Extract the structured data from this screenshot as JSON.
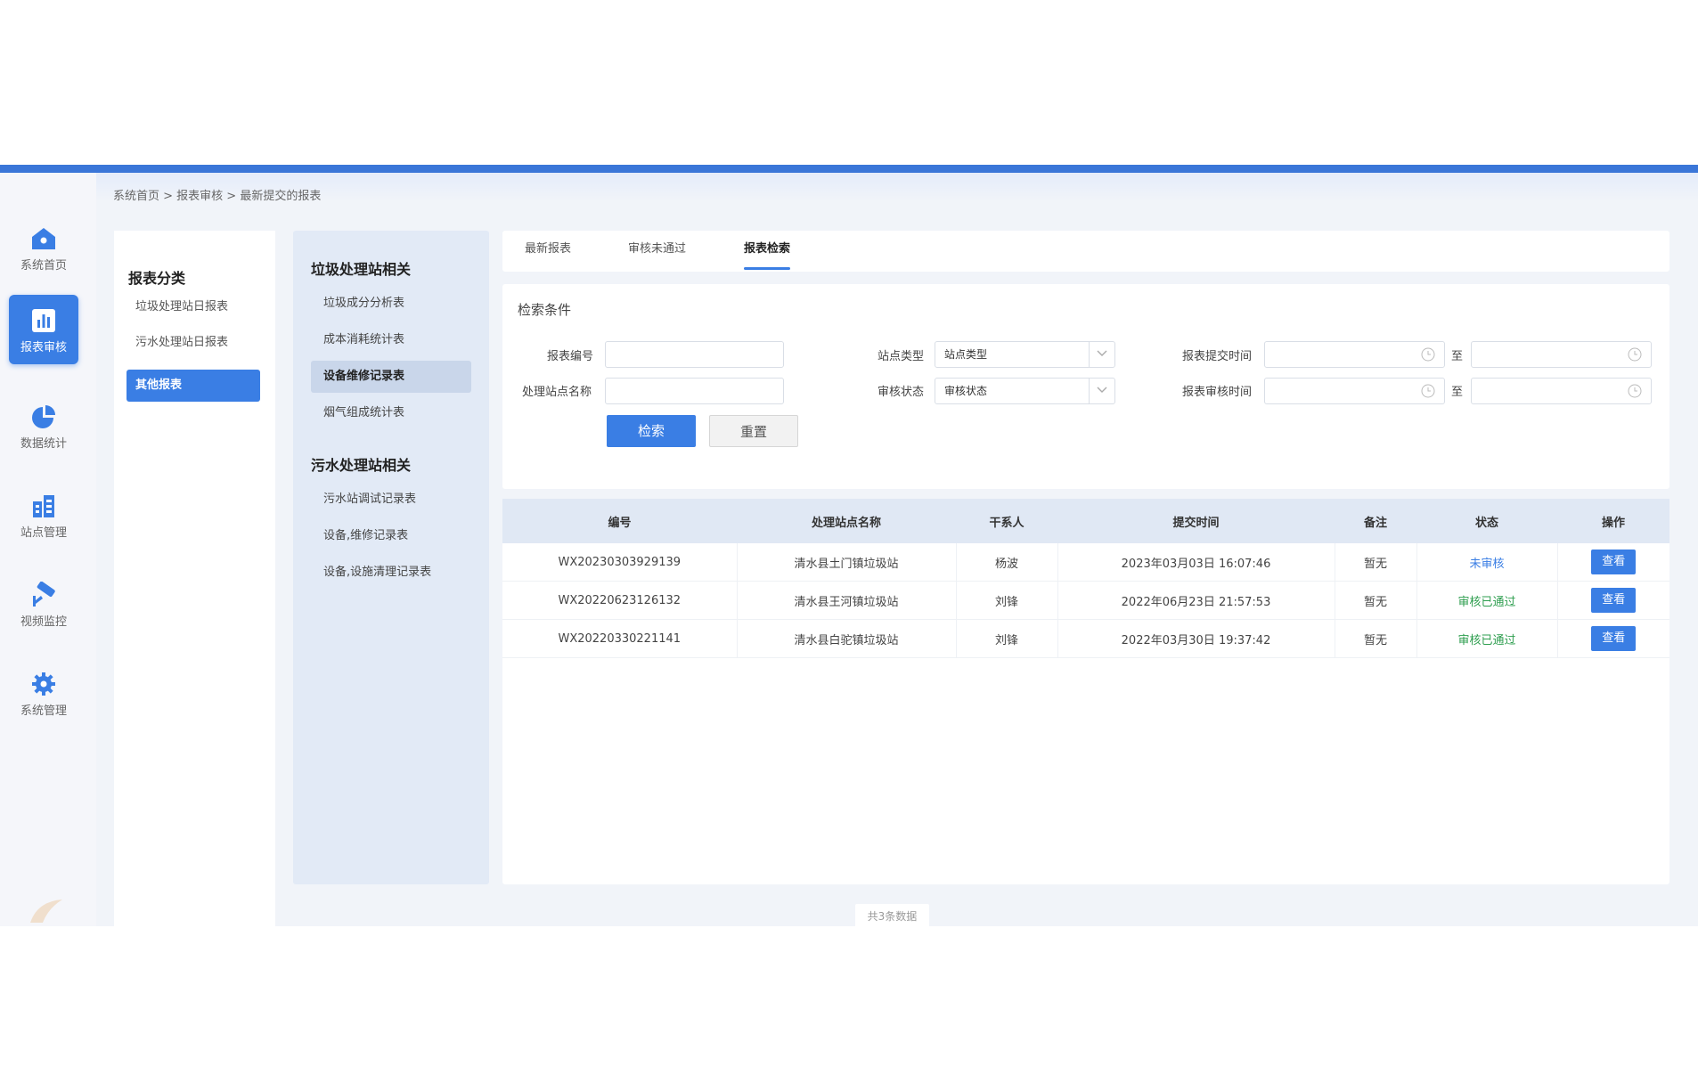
{
  "nav": {
    "items": [
      {
        "label": "系统首页",
        "icon": "home-icon",
        "active": false
      },
      {
        "label": "报表审核",
        "icon": "bar-chart-icon",
        "active": true
      },
      {
        "label": "数据统计",
        "icon": "pie-chart-icon",
        "active": false
      },
      {
        "label": "站点管理",
        "icon": "building-icon",
        "active": false
      },
      {
        "label": "视频监控",
        "icon": "camera-icon",
        "active": false
      },
      {
        "label": "系统管理",
        "icon": "gear-icon",
        "active": false
      }
    ]
  },
  "breadcrumb": "系统首页 > 报表审核 > 最新提交的报表",
  "categories": {
    "title": "报表分类",
    "items": [
      {
        "label": "垃圾处理站日报表",
        "active": false
      },
      {
        "label": "污水处理站日报表",
        "active": false
      },
      {
        "label": "其他报表",
        "active": true
      }
    ]
  },
  "subnav": {
    "groups": [
      {
        "title": "垃圾处理站相关",
        "items": [
          {
            "label": "垃圾成分分析表",
            "active": false
          },
          {
            "label": "成本消耗统计表",
            "active": false
          },
          {
            "label": "设备维修记录表",
            "active": true
          },
          {
            "label": "烟气组成统计表",
            "active": false
          }
        ]
      },
      {
        "title": "污水处理站相关",
        "items": [
          {
            "label": "污水站调试记录表",
            "active": false
          },
          {
            "label": "设备,维修记录表",
            "active": false
          },
          {
            "label": "设备,设施清理记录表",
            "active": false
          }
        ]
      }
    ]
  },
  "tabs": [
    {
      "label": "最新报表",
      "active": false
    },
    {
      "label": "审核未通过",
      "active": false
    },
    {
      "label": "报表检索",
      "active": true
    }
  ],
  "search": {
    "title": "检索条件",
    "report_no_label": "报表编号",
    "report_no_value": "",
    "station_name_label": "处理站点名称",
    "station_name_value": "",
    "site_type_label": "站点类型",
    "site_type_value": "站点类型",
    "audit_status_label": "审核状态",
    "audit_status_value": "审核状态",
    "submit_time_label": "报表提交时间",
    "audit_time_label": "报表审核时间",
    "to_label": "至",
    "search_button": "检索",
    "reset_button": "重置"
  },
  "table": {
    "columns": [
      "编号",
      "处理站点名称",
      "干系人",
      "提交时间",
      "备注",
      "状态",
      "操作"
    ],
    "rows": [
      {
        "id": "WX20230303929139",
        "station": "清水县土门镇垃圾站",
        "contact": "杨波",
        "time": "2023年03月03日 16:07:46",
        "note": "暂无",
        "status": "未审核",
        "status_kind": "pending",
        "action": "查看"
      },
      {
        "id": "WX20220623126132",
        "station": "清水县王河镇垃圾站",
        "contact": "刘锋",
        "time": "2022年06月23日 21:57:53",
        "note": "暂无",
        "status": "审核已通过",
        "status_kind": "passed",
        "action": "查看"
      },
      {
        "id": "WX20220330221141",
        "station": "清水县白驼镇垃圾站",
        "contact": "刘锋",
        "time": "2022年03月30日 19:37:42",
        "note": "暂无",
        "status": "审核已通过",
        "status_kind": "passed",
        "action": "查看"
      }
    ]
  },
  "footer": {
    "total": "共3条数据"
  },
  "colors": {
    "accent": "#3a7ee4",
    "passed": "#2e9e4f",
    "pending": "#3a7ee4",
    "topbar": "#3a76d8"
  }
}
